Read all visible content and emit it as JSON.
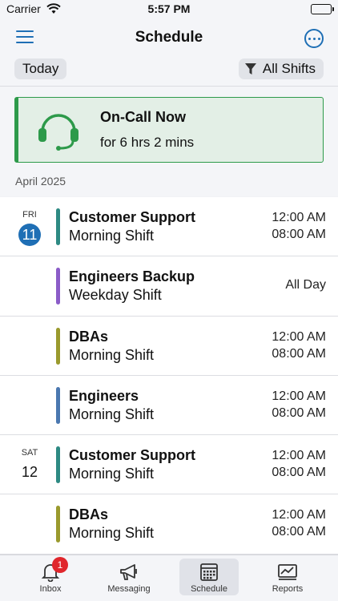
{
  "status_bar": {
    "carrier": "Carrier",
    "time": "5:57 PM"
  },
  "nav": {
    "title": "Schedule"
  },
  "filters": {
    "today": "Today",
    "shifts": "All Shifts"
  },
  "oncall": {
    "title": "On-Call Now",
    "duration": "for 6 hrs 2 mins",
    "color": "#2d9a4a"
  },
  "month": "April 2025",
  "shifts": [
    {
      "dow": "FRI",
      "day": "11",
      "today": true,
      "title": "Customer Support",
      "subtitle": "Morning Shift",
      "start": "12:00 AM",
      "end": "08:00 AM",
      "color": "#2e8a83"
    },
    {
      "dow": "",
      "day": "",
      "today": false,
      "title": "Engineers Backup",
      "subtitle": "Weekday Shift",
      "allday": "All Day",
      "color": "#8b5cc8"
    },
    {
      "dow": "",
      "day": "",
      "today": false,
      "title": "DBAs",
      "subtitle": "Morning Shift",
      "start": "12:00 AM",
      "end": "08:00 AM",
      "color": "#9a9a2e"
    },
    {
      "dow": "",
      "day": "",
      "today": false,
      "title": "Engineers",
      "subtitle": "Morning Shift",
      "start": "12:00 AM",
      "end": "08:00 AM",
      "color": "#4b78b0"
    },
    {
      "dow": "SAT",
      "day": "12",
      "today": false,
      "title": "Customer Support",
      "subtitle": "Morning Shift",
      "start": "12:00 AM",
      "end": "08:00 AM",
      "color": "#2e8a83"
    },
    {
      "dow": "",
      "day": "",
      "today": false,
      "title": "DBAs",
      "subtitle": "Morning Shift",
      "start": "12:00 AM",
      "end": "08:00 AM",
      "color": "#9a9a2e"
    }
  ],
  "tabs": [
    {
      "label": "Inbox",
      "icon": "bell-icon",
      "badge": "1"
    },
    {
      "label": "Messaging",
      "icon": "megaphone-icon"
    },
    {
      "label": "Schedule",
      "icon": "calendar-icon",
      "active": true
    },
    {
      "label": "Reports",
      "icon": "chart-icon"
    }
  ],
  "accent_color": "#1f6fb5"
}
